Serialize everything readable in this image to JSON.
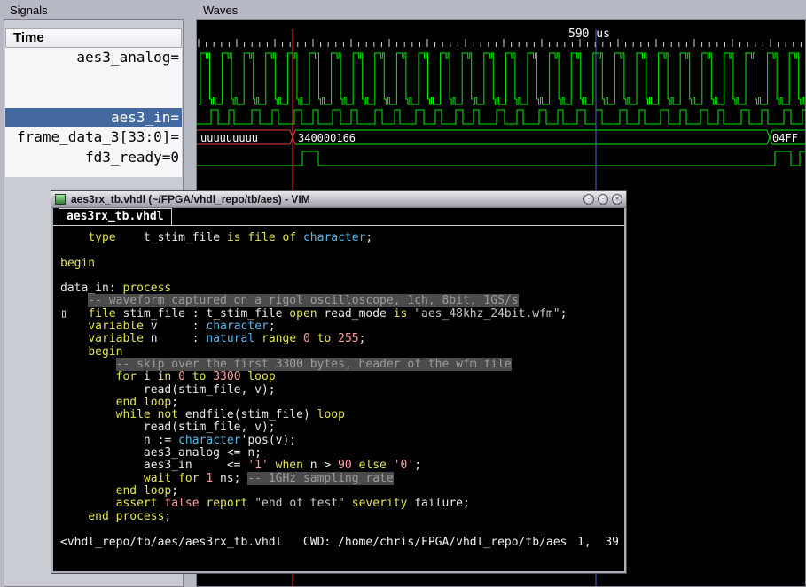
{
  "signals_panel": {
    "frame_label": "Signals",
    "time_header": "Time",
    "selected_row_color": "#44699e",
    "rows": [
      {
        "label": "aes3_analog=",
        "selected": false
      },
      {
        "label": "",
        "selected": false
      },
      {
        "label": "",
        "selected": false
      },
      {
        "label": "aes3_in=",
        "selected": true
      },
      {
        "label": "frame_data_3[33:0]=",
        "selected": false
      },
      {
        "label": "fd3_ready=0",
        "selected": false
      }
    ]
  },
  "waves_panel": {
    "frame_label": "Waves",
    "timeline_label": "590 us",
    "bus_values": [
      "uuuuuuuuu",
      "340000166",
      "04FF"
    ],
    "colors": {
      "trace_green": "#00ee00",
      "undefined_red": "#e04545",
      "cursor_red": "#ff2a2a",
      "marker_blue": "#4f5fd0",
      "text": "#ffffff"
    }
  },
  "vim": {
    "titlebar": {
      "title": "aes3rx_tb.vhdl (~/FPGA/vhdl_repo/tb/aes) - VIM",
      "button_glyphs": [
        "·",
        "·",
        "×"
      ]
    },
    "tab": "aes3rx_tb.vhdl",
    "status_left": "<vhdl_repo/tb/aes/aes3rx_tb.vhdl   CWD: /home/chris/FPGA/vhdl_repo/tb/aes",
    "status_right": "1,  39",
    "code": [
      [
        [
          "w",
          "    "
        ],
        [
          "k",
          "type"
        ],
        [
          "w",
          "    t_stim_file "
        ],
        [
          "k",
          "is"
        ],
        [
          "w",
          " "
        ],
        [
          "k",
          "file"
        ],
        [
          "w",
          " "
        ],
        [
          "k",
          "of"
        ],
        [
          "w",
          " "
        ],
        [
          "t",
          "character"
        ],
        [
          "w",
          ";"
        ]
      ],
      [],
      [
        [
          "k",
          "begin"
        ]
      ],
      [],
      [
        [
          "w",
          "data_in: "
        ],
        [
          "k",
          "process"
        ]
      ],
      [
        [
          "w",
          "    "
        ],
        [
          "c",
          "-- waveform captured on a rigol oscilloscope, 1ch, 8bit, 1GS/s"
        ]
      ],
      [
        [
          "sign",
          "▯"
        ],
        [
          "w",
          "   "
        ],
        [
          "k",
          "file"
        ],
        [
          "w",
          " stim_file : t_stim_file "
        ],
        [
          "k",
          "open"
        ],
        [
          "w",
          " read_mode "
        ],
        [
          "k",
          "is"
        ],
        [
          "w",
          " "
        ],
        [
          "s",
          "\"aes_48khz_24bit.wfm\""
        ],
        [
          "w",
          ";"
        ]
      ],
      [
        [
          "w",
          "    "
        ],
        [
          "k",
          "variable"
        ],
        [
          "w",
          " v     : "
        ],
        [
          "t",
          "character"
        ],
        [
          "w",
          ";"
        ]
      ],
      [
        [
          "w",
          "    "
        ],
        [
          "k",
          "variable"
        ],
        [
          "w",
          " n     : "
        ],
        [
          "t",
          "natural"
        ],
        [
          "w",
          " "
        ],
        [
          "k",
          "range"
        ],
        [
          "w",
          " "
        ],
        [
          "n",
          "0"
        ],
        [
          "w",
          " "
        ],
        [
          "k",
          "to"
        ],
        [
          "w",
          " "
        ],
        [
          "n",
          "255"
        ],
        [
          "w",
          ";"
        ]
      ],
      [
        [
          "w",
          "    "
        ],
        [
          "k",
          "begin"
        ]
      ],
      [
        [
          "w",
          "        "
        ],
        [
          "c",
          "-- skip over the first 3300 bytes, header of the wfm file"
        ]
      ],
      [
        [
          "w",
          "        "
        ],
        [
          "k",
          "for"
        ],
        [
          "w",
          " i "
        ],
        [
          "k",
          "in"
        ],
        [
          "w",
          " "
        ],
        [
          "n",
          "0"
        ],
        [
          "w",
          " "
        ],
        [
          "k",
          "to"
        ],
        [
          "w",
          " "
        ],
        [
          "n",
          "3300"
        ],
        [
          "w",
          " "
        ],
        [
          "k",
          "loop"
        ]
      ],
      [
        [
          "w",
          "            read(stim_file, v);"
        ]
      ],
      [
        [
          "w",
          "        "
        ],
        [
          "k",
          "end"
        ],
        [
          "w",
          " "
        ],
        [
          "k",
          "loop"
        ],
        [
          "w",
          ";"
        ]
      ],
      [
        [
          "w",
          "        "
        ],
        [
          "k",
          "while"
        ],
        [
          "w",
          " "
        ],
        [
          "k",
          "not"
        ],
        [
          "w",
          " endfile(stim_file) "
        ],
        [
          "k",
          "loop"
        ]
      ],
      [
        [
          "w",
          "            read(stim_file, v);"
        ]
      ],
      [
        [
          "w",
          "            n := "
        ],
        [
          "t",
          "character"
        ],
        [
          "w",
          "'pos(v);"
        ]
      ],
      [
        [
          "w",
          "            aes3_analog <= n;"
        ]
      ],
      [
        [
          "w",
          "            aes3_in     <= "
        ],
        [
          "n",
          "'1'"
        ],
        [
          "w",
          " "
        ],
        [
          "k",
          "when"
        ],
        [
          "w",
          " n > "
        ],
        [
          "n",
          "90"
        ],
        [
          "w",
          " "
        ],
        [
          "k",
          "else"
        ],
        [
          "w",
          " "
        ],
        [
          "n",
          "'0'"
        ],
        [
          "w",
          ";"
        ]
      ],
      [
        [
          "w",
          "            "
        ],
        [
          "k",
          "wait"
        ],
        [
          "w",
          " "
        ],
        [
          "k",
          "for"
        ],
        [
          "w",
          " "
        ],
        [
          "n",
          "1"
        ],
        [
          "w",
          " ns; "
        ],
        [
          "c",
          "-- 1GHz sampling rate"
        ]
      ],
      [
        [
          "w",
          "        "
        ],
        [
          "k",
          "end"
        ],
        [
          "w",
          " "
        ],
        [
          "k",
          "loop"
        ],
        [
          "w",
          ";"
        ]
      ],
      [
        [
          "w",
          "        "
        ],
        [
          "k",
          "assert"
        ],
        [
          "w",
          " "
        ],
        [
          "n",
          "false"
        ],
        [
          "w",
          " "
        ],
        [
          "k",
          "report"
        ],
        [
          "w",
          " "
        ],
        [
          "s",
          "\"end of test\""
        ],
        [
          "w",
          " "
        ],
        [
          "k",
          "severity"
        ],
        [
          "w",
          " failure;"
        ]
      ],
      [
        [
          "w",
          "    "
        ],
        [
          "k",
          "end"
        ],
        [
          "w",
          " "
        ],
        [
          "k",
          "process"
        ],
        [
          "w",
          ";"
        ]
      ]
    ]
  }
}
